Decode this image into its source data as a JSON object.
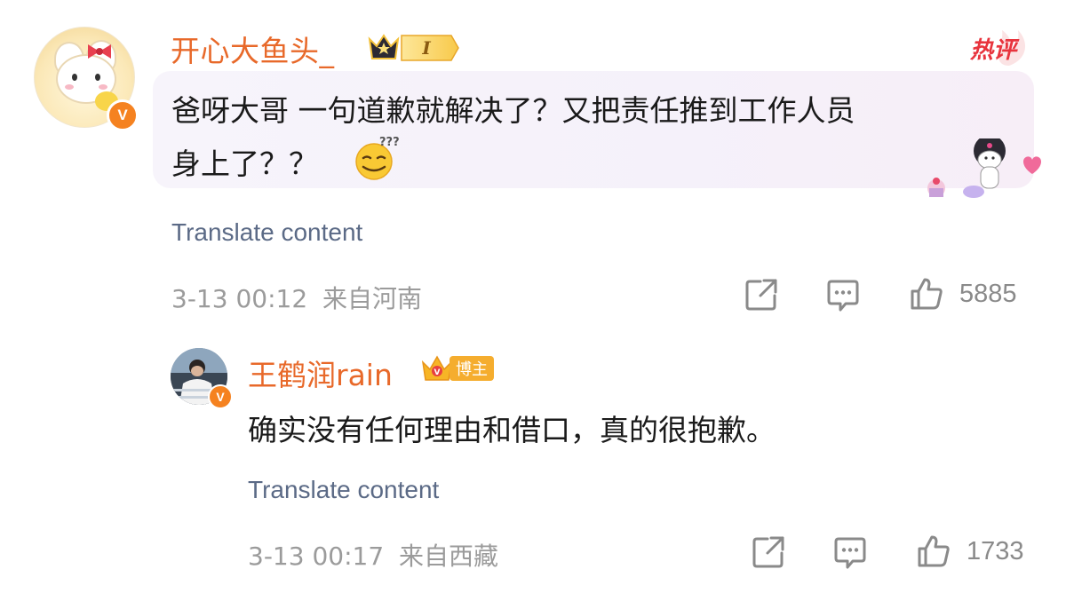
{
  "top_comment": {
    "username": "开心大鱼头_",
    "level_badge": "I",
    "hot_label": "热评",
    "text_line1": "爸呀大哥 一句道歉就解决了？又把责任推到工作人员",
    "text_line2": "身上了？？",
    "emoji": "confused-smile-emoji",
    "translate_label": "Translate content",
    "timestamp": "3-13 00:12",
    "location": "来自河南",
    "like_count": "5885",
    "verified_badge": "V",
    "accent_color": "#e8692a"
  },
  "reply": {
    "username": "王鹤润rain",
    "role_badge": "博主",
    "text": "确实没有任何理由和借口，真的很抱歉。",
    "translate_label": "Translate content",
    "timestamp": "3-13 00:17",
    "location": "来自西藏",
    "like_count": "1733",
    "verified_badge": "V"
  }
}
